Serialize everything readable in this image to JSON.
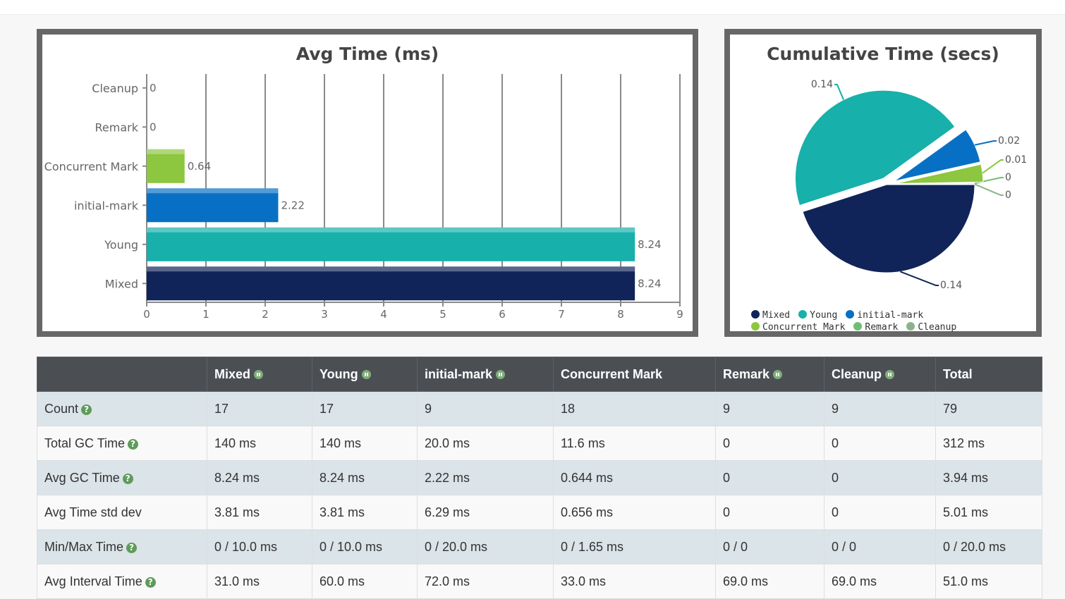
{
  "bar_chart_title": "Avg Time (ms)",
  "pie_chart_title": "Cumulative Time (secs)",
  "colors": {
    "Mixed": "#10245a",
    "Young": "#17b0aa",
    "initial-mark": "#0870c4",
    "Concurrent Mark": "#8dc63f",
    "Remark": "#6fbf73",
    "Cleanup": "#8bb38b"
  },
  "chart_data": [
    {
      "type": "bar",
      "orientation": "horizontal",
      "title": "Avg Time (ms)",
      "categories": [
        "Cleanup",
        "Remark",
        "Concurrent Mark",
        "initial-mark",
        "Young",
        "Mixed"
      ],
      "values": [
        0,
        0,
        0.64,
        2.22,
        8.24,
        8.24
      ],
      "value_labels": [
        "0",
        "0",
        "0.64",
        "2.22",
        "8.24",
        "8.24"
      ],
      "xlim": [
        0,
        9
      ],
      "xticks": [
        "0",
        "1",
        "2",
        "3",
        "4",
        "5",
        "6",
        "7",
        "8",
        "9"
      ],
      "grid": true
    },
    {
      "type": "pie",
      "title": "Cumulative Time (secs)",
      "labels": [
        "Mixed",
        "Young",
        "initial-mark",
        "Concurrent Mark",
        "Remark",
        "Cleanup"
      ],
      "values": [
        0.14,
        0.14,
        0.02,
        0.01,
        0,
        0
      ],
      "value_labels": [
        "0.14",
        "0.14",
        "0.02",
        "0.01",
        "0",
        "0"
      ],
      "legend": "bottom"
    }
  ],
  "table": {
    "headers": [
      {
        "label": "",
        "info": false
      },
      {
        "label": "Mixed",
        "info": true
      },
      {
        "label": "Young",
        "info": true
      },
      {
        "label": "initial-mark",
        "info": true
      },
      {
        "label": "Concurrent Mark",
        "info": false
      },
      {
        "label": "Remark",
        "info": true
      },
      {
        "label": "Cleanup",
        "info": true
      },
      {
        "label": "Total",
        "info": false
      }
    ],
    "rows": [
      {
        "label": "Count",
        "help": true,
        "cells": [
          "17",
          "17",
          "9",
          "18",
          "9",
          "9",
          "79"
        ]
      },
      {
        "label": "Total GC Time",
        "help": true,
        "cells": [
          "140 ms",
          "140 ms",
          "20.0 ms",
          "11.6 ms",
          "0",
          "0",
          "312 ms"
        ]
      },
      {
        "label": "Avg GC Time",
        "help": true,
        "cells": [
          "8.24 ms",
          "8.24 ms",
          "2.22 ms",
          "0.644 ms",
          "0",
          "0",
          "3.94 ms"
        ]
      },
      {
        "label": "Avg Time std dev",
        "help": false,
        "cells": [
          "3.81 ms",
          "3.81 ms",
          "6.29 ms",
          "0.656 ms",
          "0",
          "0",
          "5.01 ms"
        ]
      },
      {
        "label": "Min/Max Time",
        "help": true,
        "cells": [
          "0 / 10.0 ms",
          "0 / 10.0 ms",
          "0 / 20.0 ms",
          "0 / 1.65 ms",
          "0 / 0",
          "0 / 0",
          "0 / 20.0 ms"
        ]
      },
      {
        "label": "Avg Interval Time",
        "help": true,
        "cells": [
          "31.0 ms",
          "60.0 ms",
          "72.0 ms",
          "33.0 ms",
          "69.0 ms",
          "69.0 ms",
          "51.0 ms"
        ]
      }
    ]
  }
}
